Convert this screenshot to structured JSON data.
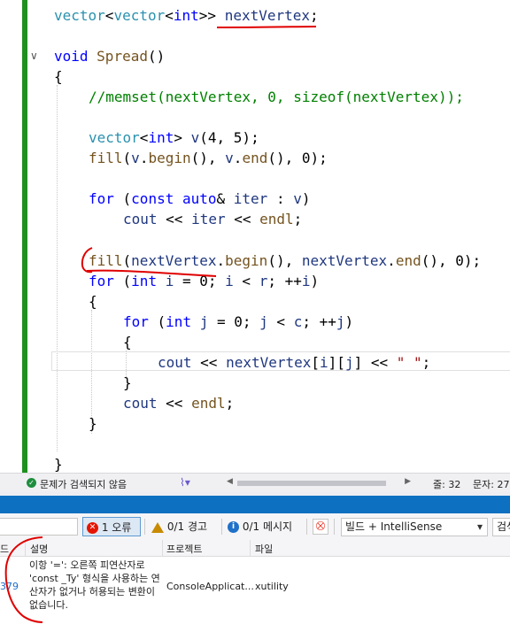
{
  "editor": {
    "lines": {
      "decl": {
        "vector1": "vector",
        "lt1": "<",
        "vector2": "vector",
        "lt2": "<",
        "int": "int",
        "gt": ">>",
        "space": " ",
        "name": "nextVertex",
        "semi": ";"
      },
      "func": {
        "void": "void",
        "space": " ",
        "name": "Spread",
        "parens": "()"
      },
      "open_brace": "{",
      "comment": "//memset(nextVertex, 0, sizeof(nextVertex));",
      "vec_v": {
        "vector": "vector",
        "lt": "<",
        "int": "int",
        "gt": ">",
        "space": " ",
        "var": "v",
        "args": "(4, 5);"
      },
      "fill_v": {
        "fill": "fill",
        "p1": "(",
        "v1": "v",
        "p2": ".",
        "begin": "begin",
        "p3": "(), ",
        "v2": "v",
        "p4": ".",
        "end": "end",
        "p5": "(), 0);"
      },
      "for1": {
        "for": "for",
        "p1": " (",
        "const": "const",
        "sp": " ",
        "auto": "auto",
        "p2": "& ",
        "iter": "iter",
        "p3": " : ",
        "v": "v",
        "p4": ")"
      },
      "cout1": {
        "cout": "cout",
        "p1": " << ",
        "iter": "iter",
        "p2": " << ",
        "endl": "endl",
        "p3": ";"
      },
      "fill_nv": {
        "fill": "fill",
        "p1": "(",
        "nv1": "nextVertex",
        "p2": ".",
        "begin": "begin",
        "p3": "(), ",
        "nv2": "nextVertex",
        "p4": ".",
        "end": "end",
        "p5": "(), 0);"
      },
      "for2": {
        "for": "for",
        "p1": " (",
        "int": "int",
        "sp": " ",
        "i1": "i",
        "p2": " = 0; ",
        "i2": "i",
        "p3": " < ",
        "r": "r",
        "p4": "; ++",
        "i3": "i",
        "p5": ")"
      },
      "brace2": "{",
      "for3": {
        "for": "for",
        "p1": " (",
        "int": "int",
        "sp": " ",
        "j1": "j",
        "p2": " = 0; ",
        "j2": "j",
        "p3": " < ",
        "c": "c",
        "p4": "; ++",
        "j3": "j",
        "p5": ")"
      },
      "brace3": "{",
      "cout2": {
        "cout": "cout",
        "p1": " << ",
        "nv": "nextVertex",
        "p2": "[",
        "i": "i",
        "p3": "][",
        "j": "j",
        "p4": "] << ",
        "str": "\" \"",
        "p5": ";"
      },
      "close3": "}",
      "cout3": {
        "cout": "cout",
        "p1": " << ",
        "endl": "endl",
        "p2": ";"
      },
      "close2": "}",
      "close1": "}"
    },
    "fold_glyph": "∨"
  },
  "editor_status": {
    "ok_icon": "check-circle-icon",
    "no_issues": "문제가 검색되지 않음",
    "line_label": "줄: 32",
    "char_label": "문자: 27"
  },
  "error_toolbar": {
    "errors": "1 오류",
    "warnings": "0/1 경고",
    "messages": "0/1 메시지",
    "build_scope": "빌드 + IntelliSense",
    "search_placeholder": "검색"
  },
  "error_list": {
    "columns": {
      "code": "드",
      "description": "설명",
      "project": "프로젝트",
      "file": "파일"
    },
    "rows": [
      {
        "code": "379",
        "description": "이항 '=': 오른쪽 피연산자로 'const _Ty' 형식을 사용하는 연산자가 없거나 허용되는 변환이 없습니다.",
        "project": "ConsoleApplicat...",
        "file": "xutility"
      }
    ]
  },
  "colors": {
    "keyword": "#0000ff",
    "type": "#2b91af",
    "function": "#74531f",
    "variable": "#1f377f",
    "comment": "#008000",
    "string": "#a31515",
    "change_bar": "#1f8f1f",
    "panel_accent": "#0e70c0",
    "annotation": "#e00000"
  }
}
